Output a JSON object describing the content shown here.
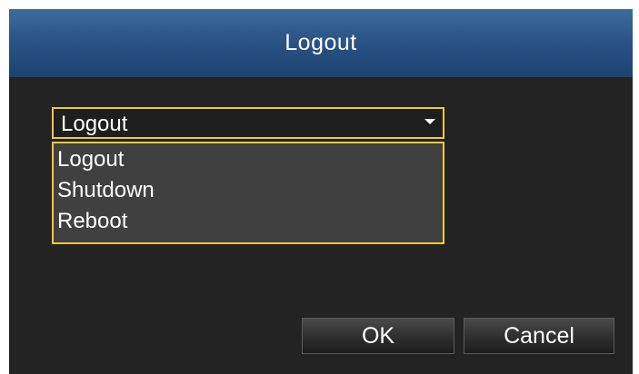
{
  "dialog": {
    "title": "Logout"
  },
  "select": {
    "selected_value": "Logout",
    "options": [
      "Logout",
      "Shutdown",
      "Reboot"
    ]
  },
  "buttons": {
    "ok_label": "OK",
    "cancel_label": "Cancel"
  },
  "colors": {
    "title_bar": "#2a5586",
    "dialog_background": "#232323",
    "dropdown_border": "#f0c93c",
    "dropdown_background": "#404040",
    "text": "#ffffff"
  }
}
